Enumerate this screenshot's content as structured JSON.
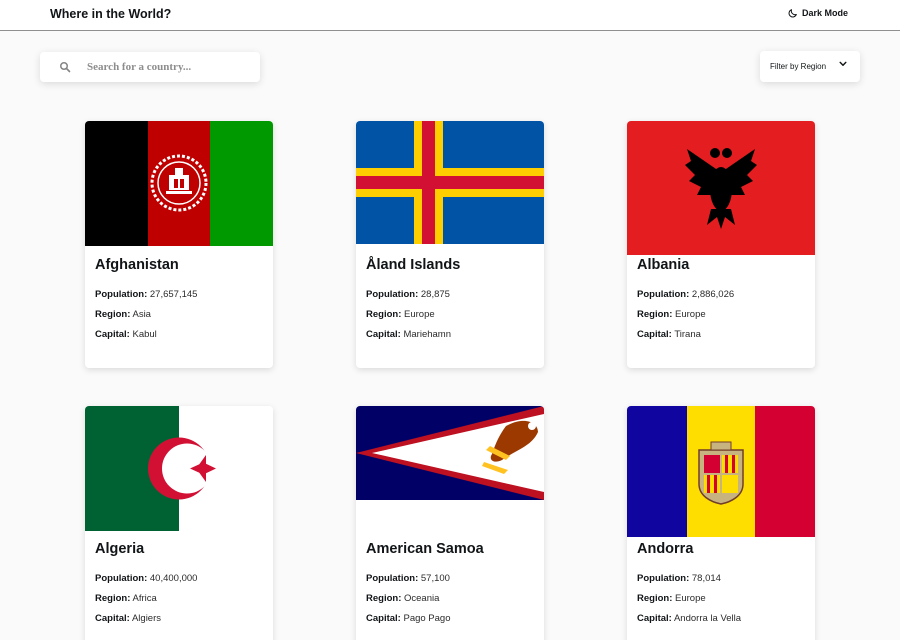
{
  "header": {
    "title": "Where in the World?",
    "mode_label": "Dark Mode"
  },
  "search": {
    "value": "",
    "placeholder": "Search for a country..."
  },
  "filter": {
    "label": "Filter by Region"
  },
  "field_labels": {
    "population": "Population:",
    "region": "Region:",
    "capital": "Capital:"
  },
  "countries": [
    {
      "name": "Afghanistan",
      "population": "27,657,145",
      "region": "Asia",
      "capital": "Kabul",
      "flag": "afghanistan-flag"
    },
    {
      "name": "Åland Islands",
      "population": "28,875",
      "region": "Europe",
      "capital": "Mariehamn",
      "flag": "aland-islands-flag"
    },
    {
      "name": "Albania",
      "population": "2,886,026",
      "region": "Europe",
      "capital": "Tirana",
      "flag": "albania-flag"
    },
    {
      "name": "Algeria",
      "population": "40,400,000",
      "region": "Africa",
      "capital": "Algiers",
      "flag": "algeria-flag"
    },
    {
      "name": "American Samoa",
      "population": "57,100",
      "region": "Oceania",
      "capital": "Pago Pago",
      "flag": "american-samoa-flag"
    },
    {
      "name": "Andorra",
      "population": "78,014",
      "region": "Europe",
      "capital": "Andorra la Vella",
      "flag": "andorra-flag"
    }
  ],
  "colors": {
    "background": "#fafafa",
    "card": "#ffffff",
    "text": "#111517"
  }
}
